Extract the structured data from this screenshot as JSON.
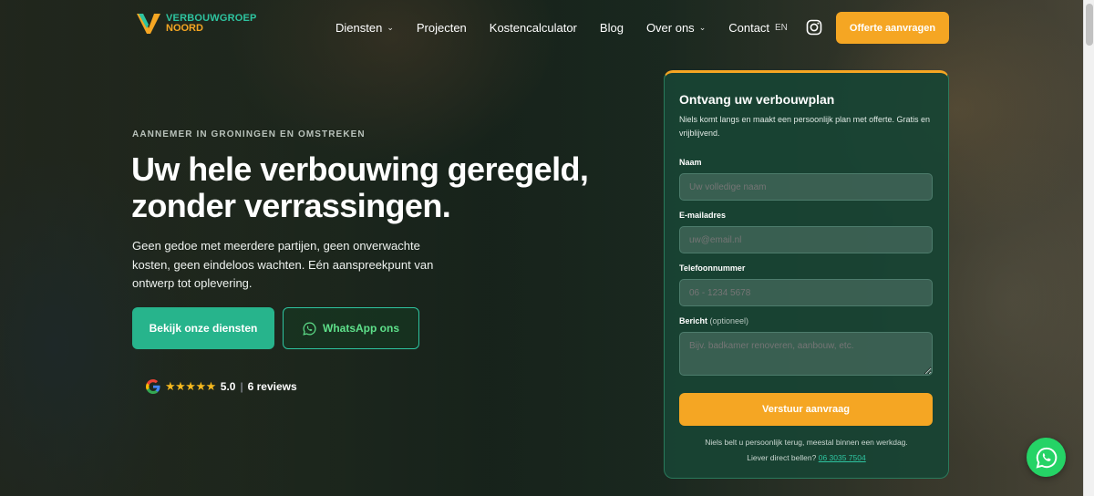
{
  "nav": {
    "logo_line1": "VERBOUWGROEP",
    "logo_line2": "NOORD",
    "items": [
      {
        "label": "Diensten",
        "dropdown": true
      },
      {
        "label": "Projecten",
        "dropdown": false
      },
      {
        "label": "Kostencalculator",
        "dropdown": false
      },
      {
        "label": "Blog",
        "dropdown": false
      },
      {
        "label": "Over ons",
        "dropdown": true
      },
      {
        "label": "Contact",
        "dropdown": false
      }
    ],
    "lang": "EN",
    "cta": "Offerte aanvragen"
  },
  "hero": {
    "eyebrow": "AANNEMER IN GRONINGEN EN OMSTREKEN",
    "headline_1": "Uw hele verbouwing geregeld,",
    "headline_2": "zonder verrassingen.",
    "subtext": "Geen gedoe met meerdere partijen, geen onverwachte kosten, geen eindeloos wachten. Eén aanspreekpunt van ontwerp tot oplevering.",
    "primary_button": "Bekijk onze diensten",
    "whatsapp_button": "WhatsApp ons",
    "rating_value": "5.0",
    "rating_stars": 5,
    "reviews": "6 reviews"
  },
  "form": {
    "title": "Ontvang uw verbouwplan",
    "intro": "Niels komt langs en maakt een persoonlijk plan met offerte. Gratis en vrijblijvend.",
    "name_label": "Naam",
    "name_placeholder": "Uw volledige naam",
    "email_label": "E-mailadres",
    "email_placeholder": "uw@email.nl",
    "phone_label": "Telefoonnummer",
    "phone_placeholder": "06 - 1234 5678",
    "message_label": "Bericht",
    "message_optional": "(optioneel)",
    "message_placeholder": "Bijv. badkamer renoveren, aanbouw, etc.",
    "submit": "Verstuur aanvraag",
    "note1": "Niels belt u persoonlijk terug, meestal binnen een werkdag.",
    "note2_prefix": "Liever direct bellen?",
    "phone_link": "06 3035 7504"
  },
  "colors": {
    "accent_orange": "#f5a623",
    "accent_green": "#27b48c",
    "whatsapp": "#25d366"
  }
}
